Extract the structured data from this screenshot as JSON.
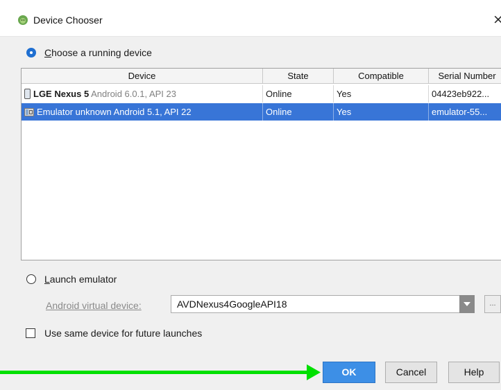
{
  "window": {
    "title": "Device Chooser",
    "close_glyph": "×",
    "app_icon": "android-studio-icon"
  },
  "running": {
    "label_first": "C",
    "label_rest": "hoose a running device",
    "selected": true
  },
  "table": {
    "columns": [
      "Device",
      "State",
      "Compatible",
      "Serial Number"
    ],
    "rows": [
      {
        "icon": "phone-icon",
        "name": "LGE Nexus 5",
        "meta": "Android 6.0.1, API 23",
        "state": "Online",
        "compatible": "Yes",
        "serial": "04423eb922...",
        "selected": false
      },
      {
        "icon": "emulator-icon",
        "name": "Emulator unknown",
        "meta": "Android 5.1, API 22",
        "state": "Online",
        "compatible": "Yes",
        "serial": "emulator-55...",
        "selected": true
      }
    ]
  },
  "launch": {
    "label_first": "L",
    "label_rest": "aunch emulator",
    "selected": false,
    "avd_label": "Android virtual device:",
    "avd_value": "AVDNexus4GoogleAPI18",
    "dots": "..."
  },
  "same_device": {
    "label": "Use same device for future launches",
    "checked": false
  },
  "buttons": {
    "ok": "OK",
    "cancel": "Cancel",
    "help": "Help"
  },
  "colors": {
    "selection": "#3875d7",
    "ok_button": "#3d8fe6",
    "annotation_arrow": "#00e000"
  }
}
